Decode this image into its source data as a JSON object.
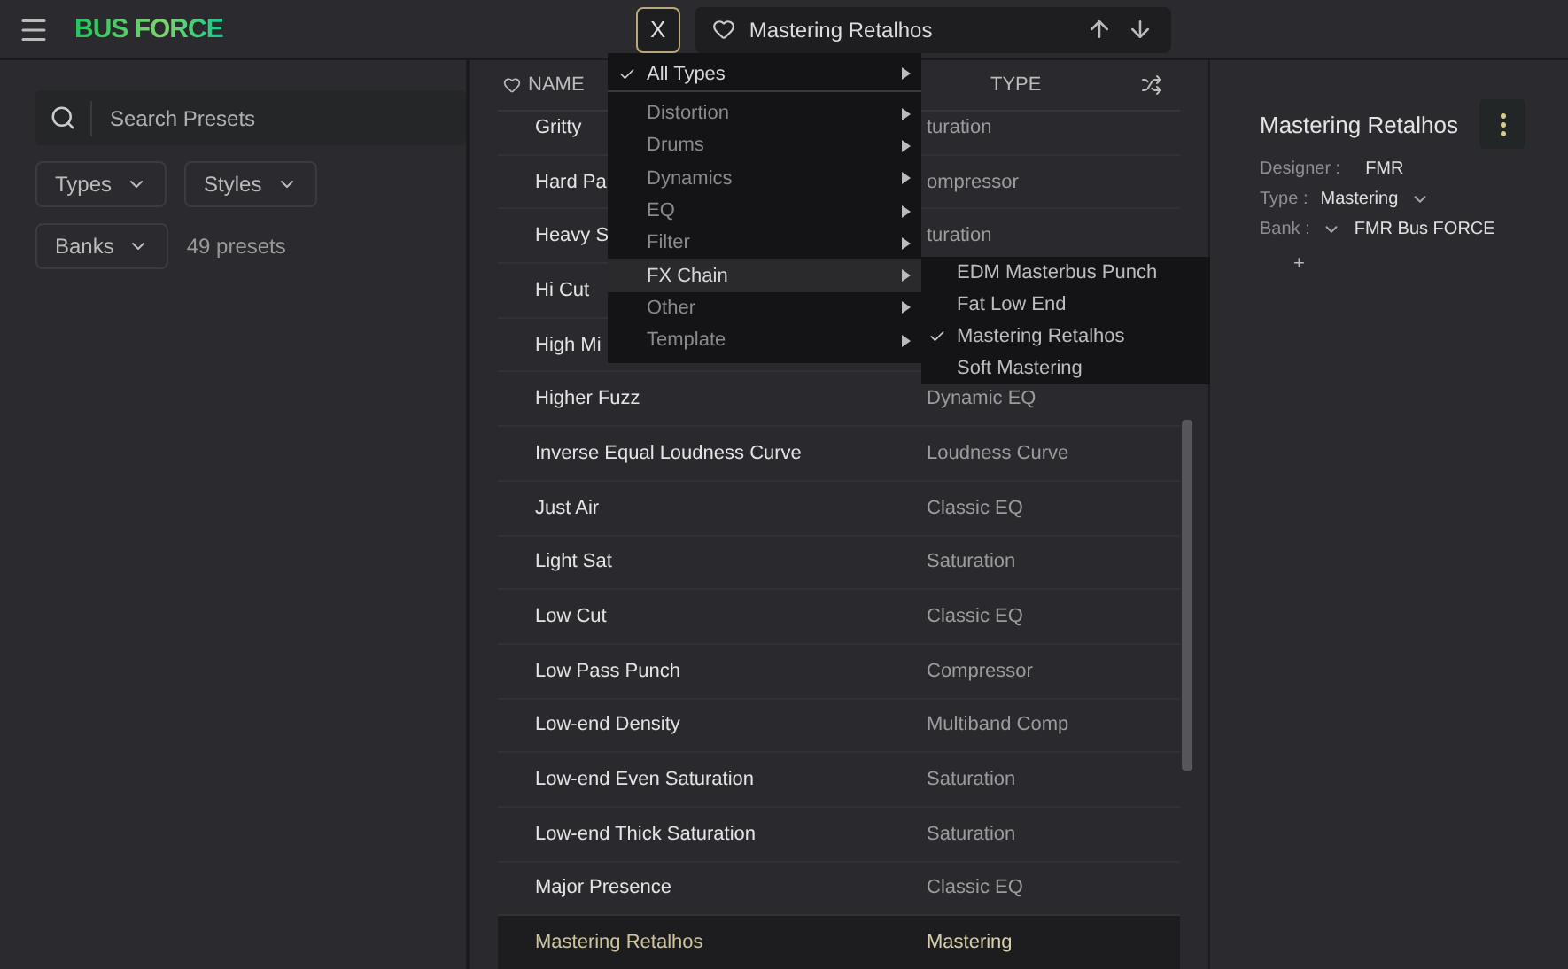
{
  "header": {
    "logo": "BUS FORCE",
    "close_label": "X",
    "preset_name": "Mastering Retalhos"
  },
  "sidebar": {
    "search_placeholder": "Search Presets",
    "filters": [
      {
        "label": "Types"
      },
      {
        "label": "Styles"
      },
      {
        "label": "Banks"
      }
    ],
    "count": "49 presets"
  },
  "table": {
    "columns": [
      "NAME",
      "TYPE"
    ],
    "rows": [
      {
        "name": "Gritty",
        "type": "turation",
        "selected": false
      },
      {
        "name": "Hard Pa",
        "type": "ompressor",
        "selected": false
      },
      {
        "name": "Heavy S",
        "type": "turation",
        "selected": false
      },
      {
        "name": "Hi Cut",
        "type": "",
        "selected": false
      },
      {
        "name": "High Mi",
        "type": "",
        "selected": false
      },
      {
        "name": "Higher Fuzz",
        "type": "Dynamic EQ",
        "selected": false
      },
      {
        "name": "Inverse Equal Loudness Curve",
        "type": "Loudness Curve",
        "selected": false
      },
      {
        "name": "Just Air",
        "type": "Classic EQ",
        "selected": false
      },
      {
        "name": "Light Sat",
        "type": "Saturation",
        "selected": false
      },
      {
        "name": "Low Cut",
        "type": "Classic EQ",
        "selected": false
      },
      {
        "name": "Low Pass Punch",
        "type": "Compressor",
        "selected": false
      },
      {
        "name": "Low-end Density",
        "type": "Multiband Comp",
        "selected": false
      },
      {
        "name": "Low-end Even Saturation",
        "type": "Saturation",
        "selected": false
      },
      {
        "name": "Low-end Thick Saturation",
        "type": "Saturation",
        "selected": false
      },
      {
        "name": "Major Presence",
        "type": "Classic EQ",
        "selected": false
      },
      {
        "name": "Mastering Retalhos",
        "type": "Mastering",
        "selected": true
      }
    ]
  },
  "type_menu": {
    "items": [
      {
        "label": "All Types",
        "checked": true,
        "expanded": false
      },
      {
        "label": "Distortion",
        "checked": false,
        "expanded": false
      },
      {
        "label": "Drums",
        "checked": false,
        "expanded": false
      },
      {
        "label": "Dynamics",
        "checked": false,
        "expanded": false
      },
      {
        "label": "EQ",
        "checked": false,
        "expanded": false
      },
      {
        "label": "Filter",
        "checked": false,
        "expanded": false
      },
      {
        "label": "FX Chain",
        "checked": false,
        "expanded": true
      },
      {
        "label": "Other",
        "checked": false,
        "expanded": false
      },
      {
        "label": "Template",
        "checked": false,
        "expanded": false
      }
    ],
    "submenu": [
      {
        "label": "EDM Masterbus Punch",
        "checked": false
      },
      {
        "label": "Fat Low End",
        "checked": false
      },
      {
        "label": "Mastering Retalhos",
        "checked": true
      },
      {
        "label": "Soft Mastering",
        "checked": false
      }
    ]
  },
  "details": {
    "title": "Mastering Retalhos",
    "designer_label": "Designer :",
    "designer": "FMR",
    "type_label": "Type :",
    "type": "Mastering",
    "bank_label": "Bank :",
    "bank": "FMR Bus FORCE",
    "add_label": "+"
  }
}
